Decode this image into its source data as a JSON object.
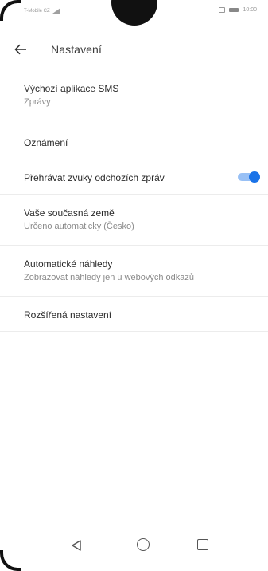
{
  "status_bar": {
    "carrier": "T-Mobile CZ",
    "time": "10:00"
  },
  "app_bar": {
    "title": "Nastavení"
  },
  "settings": {
    "default_sms_app": {
      "title": "Výchozí aplikace SMS",
      "subtitle": "Zprávy"
    },
    "notifications": {
      "title": "Oznámení"
    },
    "outgoing_sounds": {
      "title": "Přehrávat zvuky odchozích zpráv",
      "enabled": true
    },
    "current_country": {
      "title": "Vaše současná země",
      "subtitle": "Určeno automaticky (Česko)"
    },
    "auto_previews": {
      "title": "Automatické náhledy",
      "subtitle": "Zobrazovat náhledy jen u webových odkazů"
    },
    "advanced": {
      "title": "Rozšířená nastavení"
    }
  },
  "colors": {
    "accent": "#1a73e8"
  }
}
